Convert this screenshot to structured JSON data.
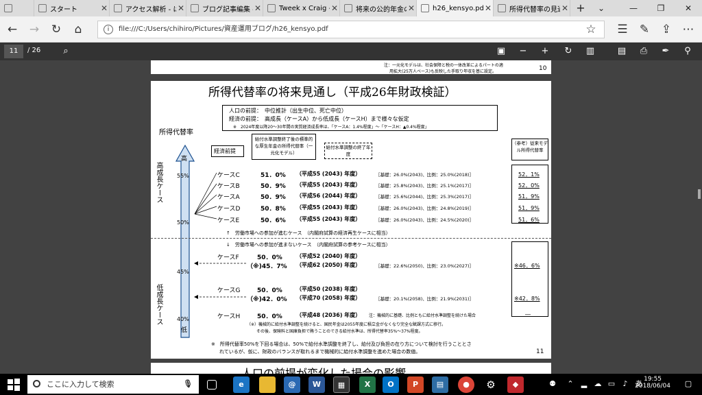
{
  "browser": {
    "tabs": [
      {
        "label": "スタート"
      },
      {
        "label": "アクセス解析 - はてな"
      },
      {
        "label": "ブログ記事編集 - は"
      },
      {
        "label": "Tweek x Craig - Ful"
      },
      {
        "label": "将来の公的年金の参"
      },
      {
        "label": "h26_kensyo.pd"
      },
      {
        "label": "所得代替率の見通し"
      }
    ],
    "new_tab": "+",
    "tab_menu": "⌄",
    "address": "file:///C:/Users/chihiro/Pictures/資産運用ブログ/h26_kensyo.pdf"
  },
  "pdf_toolbar": {
    "current_page": "11",
    "total_pages": "/ 26"
  },
  "prev_page": {
    "note_line1": "注：一元化モデルは、社会保障と税の一体改革によるパートの適",
    "note_line2": "用拡大(25万人ベース)も反映した手取り年収を基に設定。",
    "page_num": "10"
  },
  "page": {
    "title": "所得代替率の将来見通し（平成26年財政検証）",
    "premise1": "人口の前提：　中位推計（出生中位、死亡中位）",
    "premise2": "経済の前提：　高成長（ケースA）から低成長（ケースH）まで様々な仮定",
    "premise3": "※　2024年度以降20～30年間の実質経済成長率は、「ケースA：1.4%程度」～「ケースH：▲0.4%程度」",
    "y_title": "所得代替率",
    "keizai_label": "経済前提",
    "col1_label": "給付水準調整終了後の標準的な厚生年金の所得代替率（一元化モデル）",
    "col2_label": "給付水準調整の終了年度",
    "ref_label": "（参考）従来モデル所得代替率",
    "high_label": "高成長ケース",
    "low_label": "低成長ケース",
    "arrow_high": "高",
    "arrow_low": "低",
    "ticks": [
      "55%",
      "50%",
      "45%",
      "40%"
    ],
    "divider_up": "↑　労働市場への参加が進むケース　（内閣府試算の経済再生ケースに相当）",
    "divider_down": "↓　労働市場への参加が進まないケース　（内閣府試算の参考ケースに相当）",
    "high_cases": [
      {
        "name": "ケースC",
        "rate": "51．0%",
        "year": "（平成55 (2043) 年度）",
        "detail": "［基礎：26.0%(2043)、比例：25.0%(2018)］",
        "ref": "52．1%"
      },
      {
        "name": "ケースB",
        "rate": "50．9%",
        "year": "（平成55 (2043) 年度）",
        "detail": "［基礎：25.8%(2043)、比例：25.1%(2017)］",
        "ref": "52．0%"
      },
      {
        "name": "ケースA",
        "rate": "50．9%",
        "year": "（平成56 (2044) 年度）",
        "detail": "［基礎：25.6%(2044)、比例：25.3%(2017)］",
        "ref": "51．9%"
      },
      {
        "name": "ケースD",
        "rate": "50．8%",
        "year": "（平成55 (2043) 年度）",
        "detail": "［基礎：26.0%(2043)、比例：24.8%(2019)］",
        "ref": "51．9%"
      },
      {
        "name": "ケースE",
        "rate": "50．6%",
        "year": "（平成55 (2043) 年度）",
        "detail": "［基礎：26.0%(2043)、比例：24.5%(2020)］",
        "ref": "51．6%"
      }
    ],
    "low_cases": [
      {
        "name": "ケースF",
        "rate": "50．0%",
        "year": "（平成52 (2040) 年度）",
        "alt_rate": "（※)45．7%",
        "alt_year": "（平成62 (2050) 年度）",
        "detail": "［基礎：22.6%(2050)、比例：23.0%(2027)］",
        "ref": "※46．6%"
      },
      {
        "name": "ケースG",
        "rate": "50．0%",
        "year": "（平成50 (2038) 年度）",
        "alt_rate": "（※)42．0%",
        "alt_year": "（平成70 (2058) 年度）",
        "detail": "［基礎：20.1%(2058)、比例：21.9%(2031)］",
        "ref": "※42．8%"
      },
      {
        "name": "ケースH",
        "rate": "50．0%",
        "year": "（平成48 (2036) 年度）",
        "detail": "注：機械的に基礎、比例ともに給付水準調整を続けた場合",
        "ref": "―"
      }
    ],
    "caseH_note1": "（※）機械的に給付水準調整を続けると、国民年金は2055年度に積立金がなくなり完全な賦課方式に移行。",
    "caseH_note2": "その後、保険料と国庫負担で賄うことのできる給付水準は、所得代替率35%～37%程度。",
    "footnote1": "※　所得代替率50%を下回る場合は、50%で給付水準調整を終了し、給付及び負担の在り方について検討を行うこととさ",
    "footnote2": "れているが、仮に、財政のバランスが取れるまで機械的に給付水準調整を進めた場合の数値。",
    "page_num": "11"
  },
  "next_page": {
    "title": "人口の前提が変化した場合の影響"
  },
  "taskbar": {
    "search_placeholder": "ここに入力して検索",
    "time": "19:55",
    "date": "2018/06/04",
    "ime": "あ"
  }
}
